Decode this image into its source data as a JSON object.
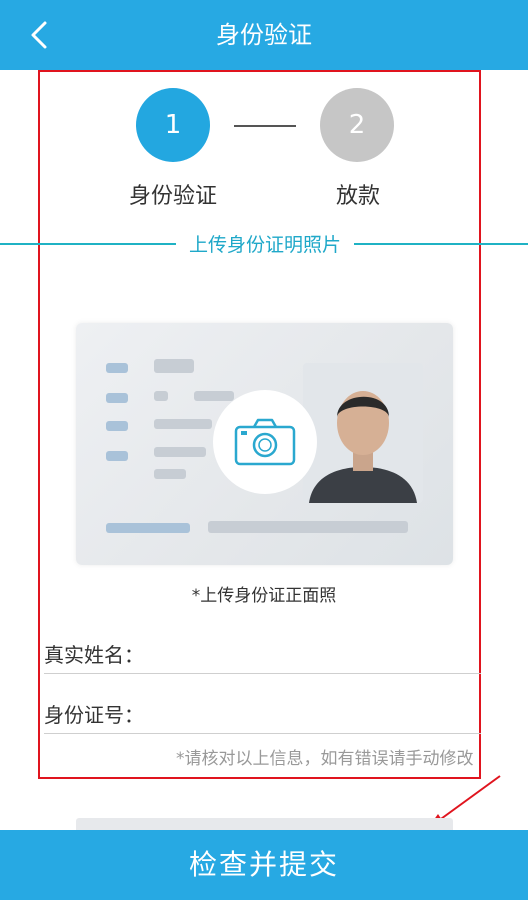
{
  "header": {
    "title": "身份验证",
    "back_icon": "chevron-left-icon"
  },
  "steps": [
    {
      "number": "1",
      "label": "身份验证",
      "state": "active",
      "color": "#23a7e0"
    },
    {
      "number": "2",
      "label": "放款",
      "state": "inactive",
      "color": "#c6c6c6"
    }
  ],
  "section": {
    "title": "上传身份证明照片"
  },
  "upload": {
    "icon": "camera-icon",
    "hint": "*上传身份证正面照"
  },
  "form": {
    "name_label": "真实姓名：",
    "name_value": "",
    "id_label": "身份证号：",
    "id_value": "",
    "verify_hint": "*请核对以上信息，如有错误请手动修改"
  },
  "submit": {
    "label": "检查并提交"
  },
  "colors": {
    "primary": "#27a9e3",
    "highlight_border": "#e0141e",
    "section_line": "#1fb2c4"
  }
}
